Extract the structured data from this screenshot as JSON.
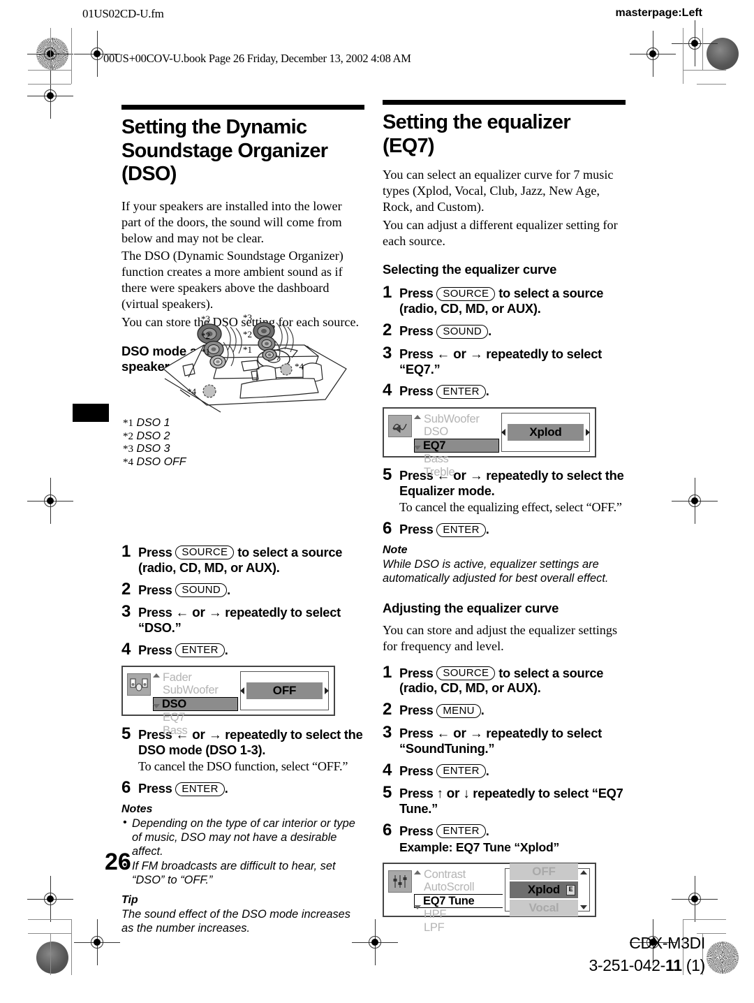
{
  "printing": {
    "fm_name": "01US02CD-U.fm",
    "masterpage": "masterpage:Left",
    "book_line": "00US+00COV-U.book  Page 26  Friday, December 13, 2002  4:08 AM",
    "page_number": "26",
    "model": "CDX-M3DI",
    "part_number_prefix": "3-251-042-",
    "part_number_bold": "11",
    "part_number_suffix": " (1)"
  },
  "left_column": {
    "title": "Setting the Dynamic Soundstage Organizer (DSO)",
    "intro": [
      "If your speakers are installed into the lower part of the doors, the sound will come from below and may not be clear.",
      "The DSO (Dynamic Soundstage Organizer) function creates a more ambient sound as if there were speakers above the dashboard (virtual speakers).",
      "You can store the DSO setting for each source."
    ],
    "figure_heading": "DSO mode and image of virtual speakers",
    "footnotes": [
      {
        "mark": "*1",
        "label": "DSO 1"
      },
      {
        "mark": "*2",
        "label": "DSO 2"
      },
      {
        "mark": "*3",
        "label": "DSO 3"
      },
      {
        "mark": "*4",
        "label": "DSO OFF"
      }
    ],
    "steps": [
      {
        "num": "1",
        "pre": "Press ",
        "key": "SOURCE",
        "post": " to select a source (radio, CD, MD, or AUX)."
      },
      {
        "num": "2",
        "pre": "Press ",
        "key": "SOUND",
        "post": "."
      },
      {
        "num": "3",
        "pre": "Press ",
        "arrows": "← or →",
        "post": " repeatedly to select “DSO.”"
      },
      {
        "num": "4",
        "pre": "Press ",
        "key": "ENTER",
        "post": "."
      }
    ],
    "lcd": {
      "icon_name": "speaker-balance-icon",
      "menu": [
        "Fader",
        "SubWoofer",
        "DSO",
        "EQ7",
        "Bass"
      ],
      "menu_selected": "DSO",
      "value": "OFF"
    },
    "steps2": [
      {
        "num": "5",
        "pre": "Press ",
        "arrows": "← or →",
        "post": " repeatedly to select the DSO mode (DSO 1-3).",
        "sub": "To cancel the DSO function, select “OFF.”"
      },
      {
        "num": "6",
        "pre": "Press ",
        "key": "ENTER",
        "post": "."
      }
    ],
    "notes_heading": "Notes",
    "notes": [
      "Depending on the type of car interior or type of music, DSO may not have a desirable affect.",
      "If FM broadcasts are difficult to hear, set “DSO” to “OFF.”"
    ],
    "tip_heading": "Tip",
    "tip": "The sound effect of the DSO mode increases as the number increases."
  },
  "right_column": {
    "title": "Setting the equalizer (EQ7)",
    "intro": [
      "You can select an equalizer curve for 7 music types (Xplod, Vocal, Club, Jazz, New Age, Rock, and Custom).",
      "You can adjust a different equalizer setting for each source."
    ],
    "section1_heading": "Selecting the equalizer curve",
    "steps1": [
      {
        "num": "1",
        "pre": "Press ",
        "key": "SOURCE",
        "post": " to select a source (radio, CD, MD, or AUX)."
      },
      {
        "num": "2",
        "pre": "Press ",
        "key": "SOUND",
        "post": "."
      },
      {
        "num": "3",
        "pre": "Press ",
        "arrows": "← or →",
        "post": " repeatedly to select “EQ7.”"
      },
      {
        "num": "4",
        "pre": "Press ",
        "key": "ENTER",
        "post": "."
      }
    ],
    "lcd1": {
      "icon_name": "equalizer-curve-icon",
      "menu": [
        "SubWoofer",
        "DSO",
        "EQ7",
        "Bass",
        "Treble"
      ],
      "menu_selected": "EQ7",
      "value": "Xplod"
    },
    "steps2": [
      {
        "num": "5",
        "pre": "Press ",
        "arrows": "← or →",
        "post": " repeatedly to select the Equalizer mode.",
        "sub": "To cancel the equalizing effect, select “OFF.”"
      },
      {
        "num": "6",
        "pre": "Press ",
        "key": "ENTER",
        "post": "."
      }
    ],
    "note_heading": "Note",
    "note": "While DSO is active, equalizer settings are automatically adjusted for best overall effect.",
    "section2_heading": "Adjusting the equalizer curve",
    "section2_intro": "You can store and adjust the equalizer settings for frequency and level.",
    "steps3": [
      {
        "num": "1",
        "pre": "Press ",
        "key": "SOURCE",
        "post": " to select a source (radio, CD, MD, or AUX)."
      },
      {
        "num": "2",
        "pre": "Press ",
        "key": "MENU",
        "post": "."
      },
      {
        "num": "3",
        "pre": "Press ",
        "arrows": "← or →",
        "post": " repeatedly to select “SoundTuning.”"
      },
      {
        "num": "4",
        "pre": "Press ",
        "key": "ENTER",
        "post": "."
      },
      {
        "num": "5",
        "pre": "Press ",
        "arrows": "↑ or ↓",
        "post": " repeatedly to select “EQ7 Tune.”"
      },
      {
        "num": "6",
        "pre": "Press ",
        "key": "ENTER",
        "post": ".",
        "subb": "Example: EQ7 Tune “Xplod”"
      }
    ],
    "lcd2": {
      "icon_name": "sound-tuning-icon",
      "menu": [
        "Contrast",
        "AutoScroll",
        "EQ7 Tune",
        "HPF",
        "LPF"
      ],
      "menu_selected": "EQ7 Tune",
      "values": [
        "OFF",
        "Xplod",
        "Vocal"
      ],
      "value_selected": "Xplod"
    }
  }
}
